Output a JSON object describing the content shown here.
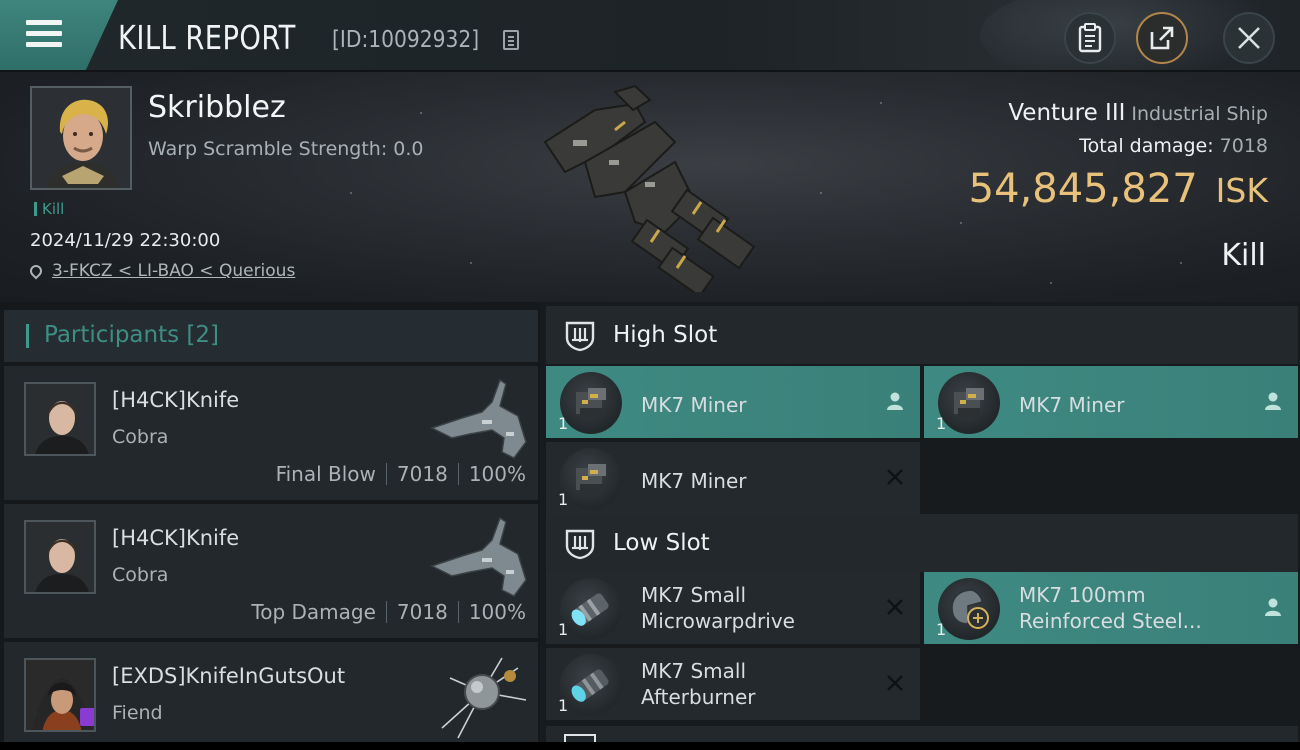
{
  "header": {
    "title": "KILL REPORT",
    "report_id": "[ID:10092932]",
    "icons": {
      "menu": "hamburger-menu-icon",
      "copy": "copy-id-icon",
      "clipboard": "clipboard-icon",
      "share": "share-icon",
      "close": "close-icon"
    }
  },
  "victim": {
    "name": "Skribblez",
    "warp_scramble": "Warp Scramble Strength: 0.0",
    "tag": "Kill",
    "time": "2024/11/29 22:30:00",
    "location": "3-FKCZ < LI-BAO < Querious",
    "ship_name": "Venture III",
    "ship_class": "Industrial Ship",
    "total_damage_label": "Total damage:",
    "total_damage": "7018",
    "isk_value": "54,845,827",
    "isk_unit": "ISK",
    "result": "Kill"
  },
  "participants": {
    "title": "Participants [2]",
    "rows": [
      {
        "name": "[H4CK]Knife",
        "ship": "Cobra",
        "role": "Final Blow",
        "damage": "7018",
        "percent": "100%"
      },
      {
        "name": "[H4CK]Knife",
        "ship": "Cobra",
        "role": "Top Damage",
        "damage": "7018",
        "percent": "100%"
      },
      {
        "name": "[EXDS]KnifeInGutsOut",
        "ship": "Fiend"
      }
    ]
  },
  "fitting": {
    "high_slot_label": "High Slot",
    "low_slot_label": "Low Slot",
    "high": [
      {
        "name": "MK7 Miner",
        "qty": "1",
        "status": "person-icon",
        "active": true
      },
      {
        "name": "MK7 Miner",
        "qty": "1",
        "status": "person-icon",
        "active": true
      },
      {
        "name": "MK7 Miner",
        "qty": "1",
        "status": "destroyed-x-icon",
        "active": false
      }
    ],
    "low": [
      {
        "name1": "MK7 Small",
        "name2": "Microwarpdrive",
        "qty": "1",
        "status": "destroyed-x-icon",
        "active": false
      },
      {
        "name1": "MK7 100mm",
        "name2": "Reinforced Steel...",
        "qty": "1",
        "status": "person-icon",
        "active": true
      },
      {
        "name1": "MK7 Small",
        "name2": "Afterburner",
        "qty": "1",
        "status": "destroyed-x-icon",
        "active": false
      }
    ]
  },
  "colors": {
    "accent": "#3f9a8e",
    "isk": "#e8c27a",
    "active_row": "#3e8a82"
  }
}
